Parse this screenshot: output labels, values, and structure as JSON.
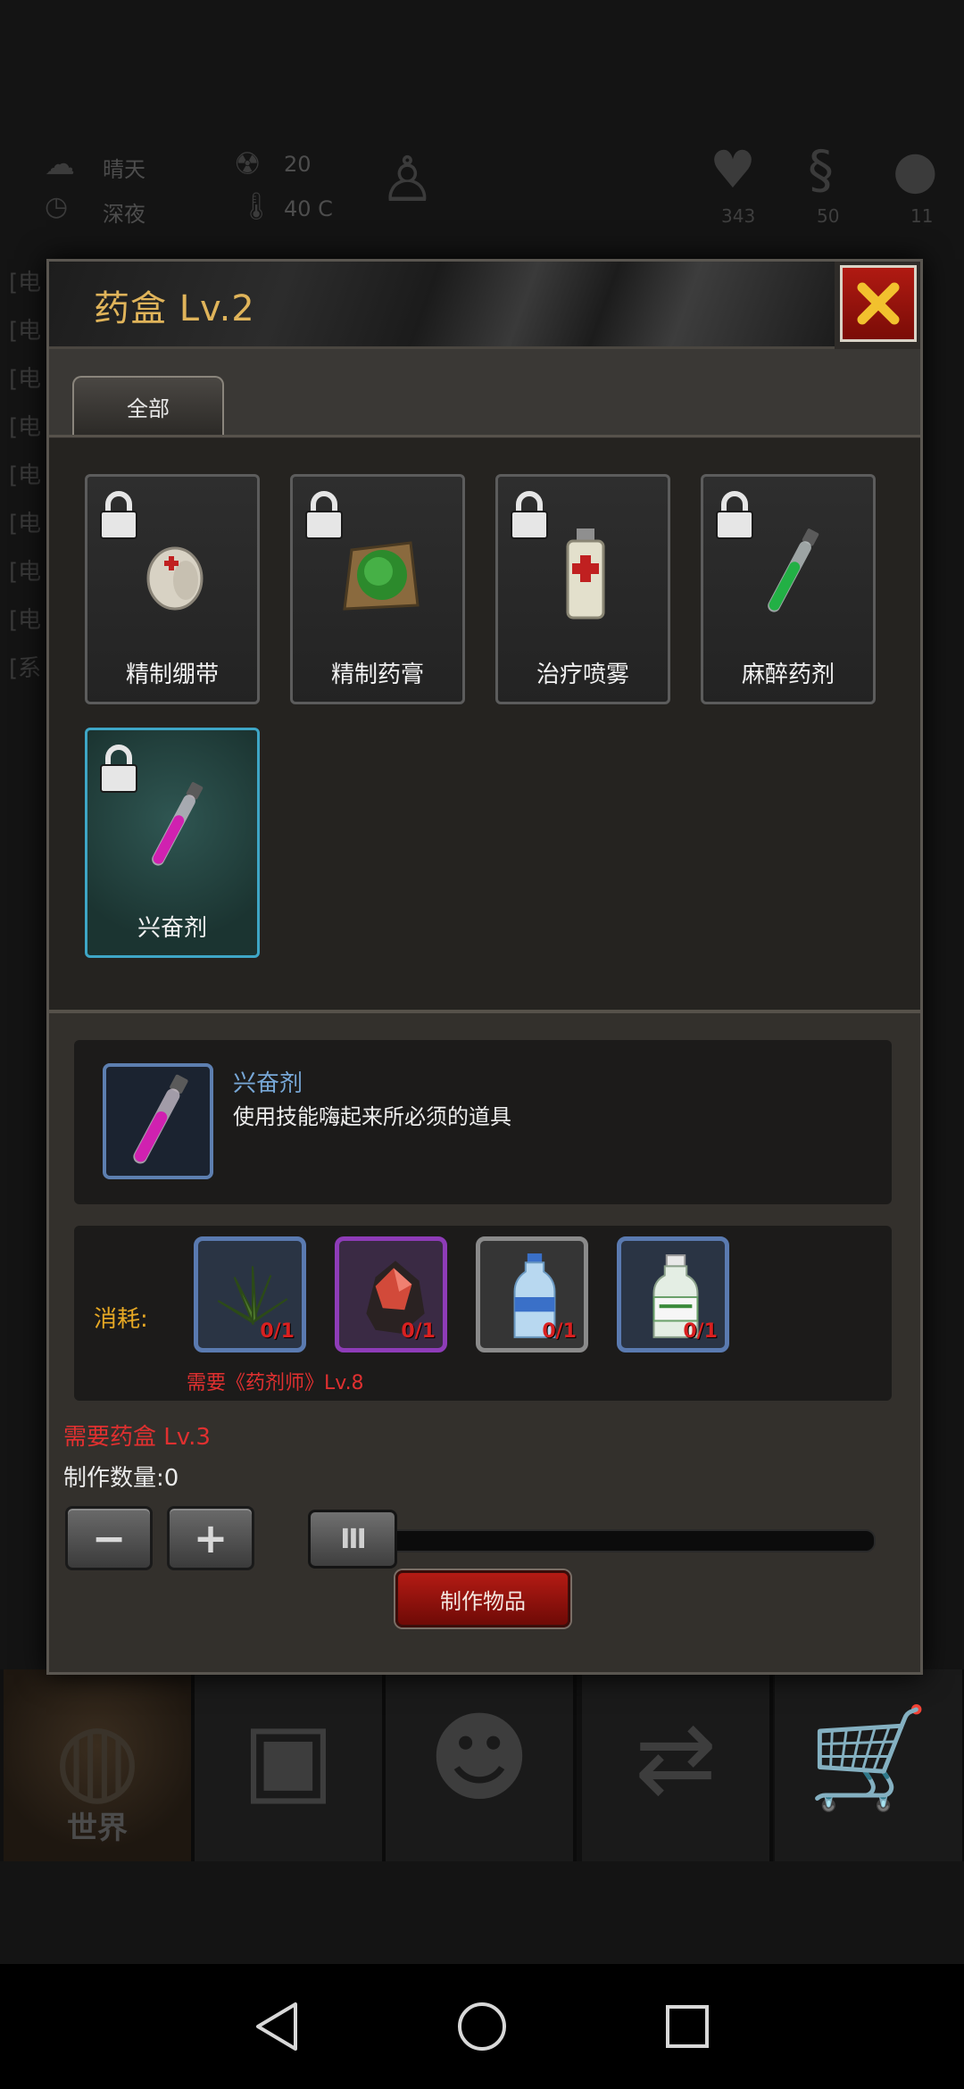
{
  "background": {
    "weather": "晴天",
    "time_of_day": "深夜",
    "radiation": "20",
    "temperature": "40 C",
    "stats": [
      "343",
      "50",
      "11"
    ],
    "log_prefixes": [
      "[电",
      "[电",
      "[电",
      "[电",
      "[电",
      "[电",
      "[电",
      "[电",
      "[系"
    ],
    "bottom_nav": [
      {
        "label": "世界",
        "icon": "globe-icon"
      },
      {
        "label": "",
        "icon": "briefcase-icon"
      },
      {
        "label": "",
        "icon": "head-gear-icon"
      },
      {
        "label": "",
        "icon": "exchange-icon"
      },
      {
        "label": "",
        "icon": "cart-icon"
      }
    ]
  },
  "dialog": {
    "title": "药盒 Lv.2",
    "close_icon": "close-icon",
    "tabs": [
      "全部"
    ],
    "items": [
      {
        "name": "精制绷带",
        "icon": "bandage-icon",
        "locked": true
      },
      {
        "name": "精制药膏",
        "icon": "ointment-icon",
        "locked": true
      },
      {
        "name": "治疗喷雾",
        "icon": "spray-can-icon",
        "locked": true
      },
      {
        "name": "麻醉药剂",
        "icon": "green-vial-icon",
        "locked": true
      },
      {
        "name": "兴奋剂",
        "icon": "pink-vial-icon",
        "locked": true,
        "selected": true
      }
    ],
    "detail": {
      "name": "兴奋剂",
      "description": "使用技能嗨起来所必须的道具",
      "icon": "pink-vial-icon"
    },
    "consume_label": "消耗:",
    "materials": [
      {
        "icon": "herb-icon",
        "count": "0/1",
        "border": "#5a7ab0"
      },
      {
        "icon": "red-crystal-icon",
        "count": "0/1",
        "border": "#8e3cb8"
      },
      {
        "icon": "water-bottle-icon",
        "count": "0/1",
        "border": "#8a8a8a"
      },
      {
        "icon": "medicine-bottle-icon",
        "count": "0/1",
        "border": "#5a7ab0"
      }
    ],
    "skill_requirement": "需要《药剂师》Lv.8",
    "level_requirement": "需要药盒 Lv.3",
    "quantity_label": "制作数量:0",
    "quantity_value": 0,
    "minus_label": "−",
    "plus_label": "+",
    "slider_thumb_label": "III",
    "craft_button": "制作物品"
  },
  "colors": {
    "title": "#e0b45a",
    "accent_blue": "#77a7d6",
    "warning_red": "#e03030",
    "consume_orange": "#e6a824",
    "craft_red": "#b41b14"
  }
}
